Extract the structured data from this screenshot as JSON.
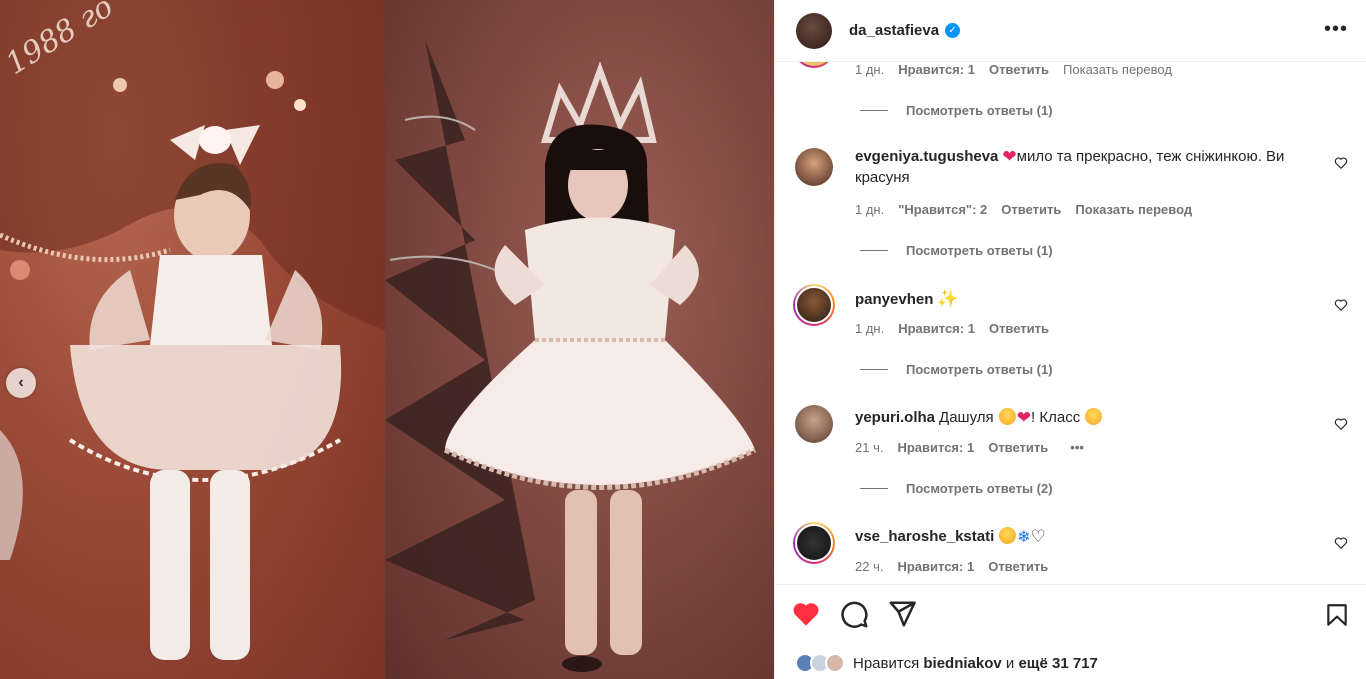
{
  "media": {
    "year_stamp": "1988 го",
    "prev_arrow": "‹"
  },
  "header": {
    "username": "da_astafieva",
    "verified_icon": "checkmark-badge-icon",
    "more": "•••"
  },
  "comments": {
    "top_partial": {
      "time": "1 дн.",
      "likes": "Нравится: 1",
      "reply": "Ответить",
      "translate": "Показать перевод",
      "view_replies": "Посмотреть ответы (1)"
    },
    "items": [
      {
        "username": "evgeniya.tugusheva",
        "text": "мило та прекрасно, теж сніжинкою. Ви красуня",
        "emoji_before": "❤",
        "time": "1 дн.",
        "likes": "\"Нравится\": 2",
        "reply": "Ответить",
        "translate": "Показать перевод",
        "view_replies": "Посмотреть ответы (1)",
        "avatar_colors": [
          "#d6a07a",
          "#4a2a20"
        ]
      },
      {
        "username": "panyevhen",
        "text": "",
        "emoji_after": "✨",
        "time": "1 дн.",
        "likes": "Нравится: 1",
        "reply": "Ответить",
        "view_replies": "Посмотреть ответы (1)",
        "avatar_colors": [
          "#8a5a3a",
          "#2a1a10"
        ]
      },
      {
        "username": "yepuri.olha",
        "text_a": "Дашуля",
        "text_b": "! Класс",
        "time": "21 ч.",
        "likes": "Нравится: 1",
        "reply": "Ответить",
        "more": "•••",
        "view_replies": "Посмотреть ответы (2)",
        "avatar_colors": [
          "#c9a28c",
          "#5a3a2c"
        ]
      },
      {
        "username": "vse_haroshe_kstati",
        "text": "",
        "time": "22 ч.",
        "likes": "Нравится: 1",
        "reply": "Ответить",
        "avatar_colors": [
          "#111111",
          "#333333"
        ]
      }
    ]
  },
  "actions": {
    "likes_prefix": "Нравится",
    "likes_user": "biedniakov",
    "likes_mid": "и",
    "likes_count": "ещё 31 717"
  },
  "colors": {
    "like_red": "#ff3040",
    "story_ring_start": "#feda75",
    "story_ring_mid": "#d62976",
    "story_ring_end": "#962fbf",
    "verified_blue": "#0095f6"
  }
}
